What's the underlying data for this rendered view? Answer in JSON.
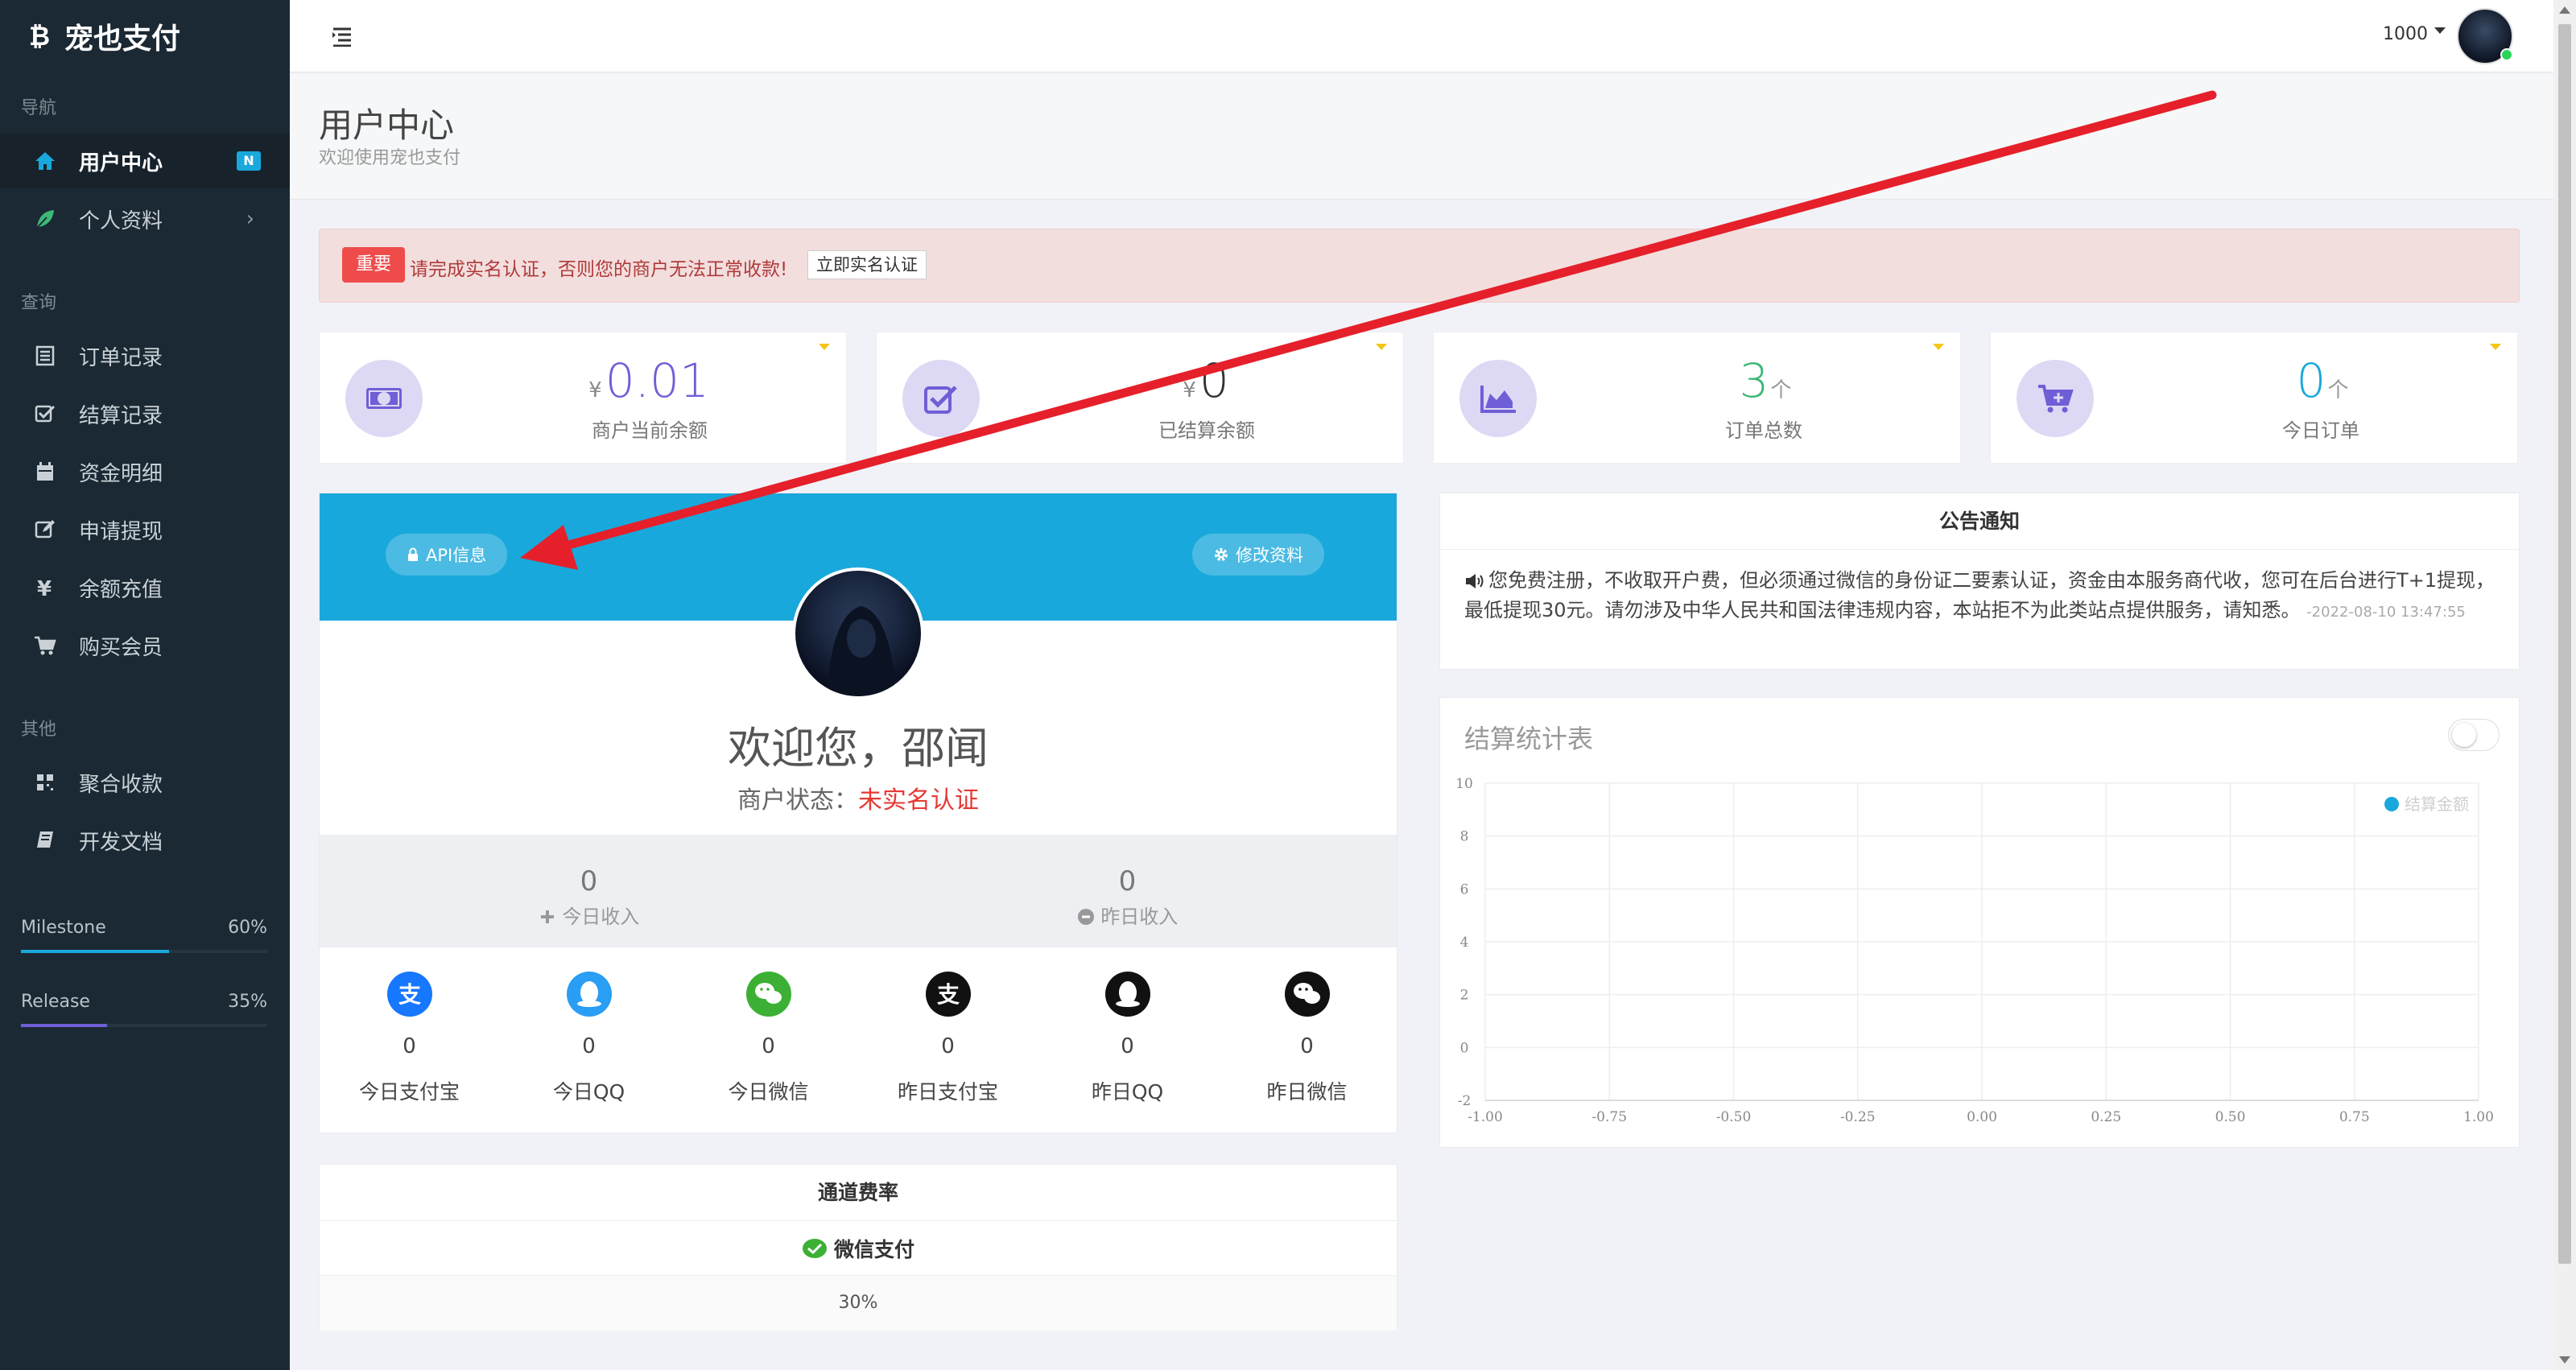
{
  "app": {
    "brand": "宠也支付"
  },
  "sidebar": {
    "sections": {
      "nav": "导航",
      "query": "查询",
      "other": "其他"
    },
    "items": [
      {
        "label": "用户中心",
        "badge": "N"
      },
      {
        "label": "个人资料"
      },
      {
        "label": "订单记录"
      },
      {
        "label": "结算记录"
      },
      {
        "label": "资金明细"
      },
      {
        "label": "申请提现"
      },
      {
        "label": "余额充值"
      },
      {
        "label": "购买会员"
      },
      {
        "label": "聚合收款"
      },
      {
        "label": "开发文档"
      }
    ],
    "progress": [
      {
        "label": "Milestone",
        "percent_text": "60%",
        "value": 0.6,
        "color": "#19a8db"
      },
      {
        "label": "Release",
        "percent_text": "35%",
        "value": 0.35,
        "color": "#6f5fd6"
      }
    ]
  },
  "topbar": {
    "user": "1000"
  },
  "page": {
    "title": "用户中心",
    "subtitle": "欢迎使用宠也支付"
  },
  "alert": {
    "tag": "重要",
    "text": "请完成实名认证，否则您的商户无法正常收款!",
    "button": "立即实名认证"
  },
  "stats": [
    {
      "prefix": "¥",
      "value": "0.01",
      "suffix": "",
      "label": "商户当前余额",
      "color": "#6f5fd6"
    },
    {
      "prefix": "¥",
      "value": "0",
      "suffix": "",
      "label": "已结算余额",
      "color": "#333333"
    },
    {
      "prefix": "",
      "value": "3",
      "suffix": "个",
      "label": "订单总数",
      "color": "#3cb878"
    },
    {
      "prefix": "",
      "value": "0",
      "suffix": "个",
      "label": "今日订单",
      "color": "#19a8db"
    }
  ],
  "profile": {
    "api_button": "API信息",
    "edit_button": "修改资料",
    "welcome": "欢迎您，邵闻",
    "status_label": "商户状态：",
    "status_value": "未实名认证",
    "today_income": {
      "value": "0",
      "label": "今日收入"
    },
    "yesterday_income": {
      "value": "0",
      "label": "昨日收入"
    },
    "channels": [
      {
        "value": "0",
        "label": "今日支付宝",
        "icon": "alipay-icon"
      },
      {
        "value": "0",
        "label": "今日QQ",
        "icon": "qq-icon"
      },
      {
        "value": "0",
        "label": "今日微信",
        "icon": "wechat-icon"
      },
      {
        "value": "0",
        "label": "昨日支付宝",
        "icon": "alipay-icon"
      },
      {
        "value": "0",
        "label": "昨日QQ",
        "icon": "qq-icon"
      },
      {
        "value": "0",
        "label": "昨日微信",
        "icon": "wechat-icon"
      }
    ]
  },
  "rates": {
    "title": "通道费率",
    "channel": "微信支付",
    "value": "30%"
  },
  "notice": {
    "title": "公告通知",
    "text": "您免费注册，不收取开户费，但必须通过微信的身份证二要素认证，资金由本服务商代收，您可在后台进行T+1提现，最低提现30元。请勿涉及中华人民共和国法律违规内容，本站拒不为此类站点提供服务，请知悉。",
    "date": "-2022-08-10 13:47:55"
  },
  "chart": {
    "title": "结算统计表"
  },
  "chart_data": {
    "type": "line",
    "title": "结算统计表",
    "x_ticks": [
      "-1.00",
      "-0.75",
      "-0.50",
      "-0.25",
      "0.00",
      "0.25",
      "0.50",
      "0.75",
      "1.00"
    ],
    "y_ticks": [
      "-2",
      "0",
      "2",
      "4",
      "6",
      "8",
      "10"
    ],
    "xlim": [
      -1,
      1
    ],
    "ylim": [
      -2,
      10
    ],
    "series": [
      {
        "name": "结算金额",
        "values": []
      }
    ],
    "legend": "top-right",
    "grid": true
  },
  "colors": {
    "sidebar": "#1b2934",
    "accent": "#19a8db",
    "danger": "#ef4b4b"
  }
}
